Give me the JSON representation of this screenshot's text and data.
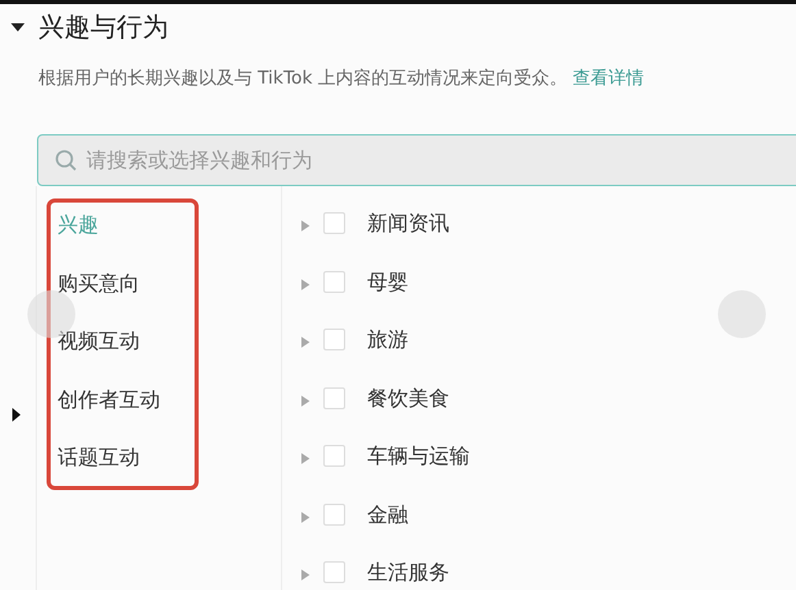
{
  "section": {
    "title": "兴趣与行为",
    "expanded": true,
    "description": "根据用户的长期兴趣以及与 TikTok 上内容的互动情况来定向受众。",
    "link": "查看详情"
  },
  "search": {
    "placeholder": "请搜索或选择兴趣和行为"
  },
  "categories": [
    {
      "label": "兴趣",
      "selected": true
    },
    {
      "label": "购买意向",
      "selected": false
    },
    {
      "label": "视频互动",
      "selected": false
    },
    {
      "label": "创作者互动",
      "selected": false
    },
    {
      "label": "话题互动",
      "selected": false
    }
  ],
  "options": [
    {
      "label": "新闻资讯",
      "checked": false
    },
    {
      "label": "母婴",
      "checked": false
    },
    {
      "label": "旅游",
      "checked": false
    },
    {
      "label": "餐饮美食",
      "checked": false
    },
    {
      "label": "车辆与运输",
      "checked": false
    },
    {
      "label": "金融",
      "checked": false
    },
    {
      "label": "生活服务",
      "checked": false
    }
  ]
}
